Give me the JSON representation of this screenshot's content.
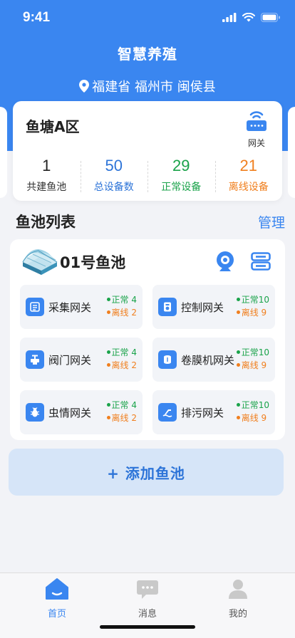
{
  "status_bar": {
    "time": "9:41"
  },
  "header": {
    "title": "智慧养殖",
    "location": "福建省 福州市 闽侯县"
  },
  "pond": {
    "name": "鱼塘A区",
    "gateway_label": "网关",
    "stats": [
      {
        "value": "1",
        "label": "共建鱼池",
        "color": "#222222"
      },
      {
        "value": "50",
        "label": "总设备数",
        "color": "#2d74d8"
      },
      {
        "value": "29",
        "label": "正常设备",
        "color": "#1aa34a"
      },
      {
        "value": "21",
        "label": "离线设备",
        "color": "#f07f1e"
      }
    ]
  },
  "section": {
    "title": "鱼池列表",
    "manage": "管理"
  },
  "pool": {
    "name": "01号鱼池",
    "gateways": [
      {
        "name": "采集网关",
        "icon": "collect-icon",
        "normal": "正常 4",
        "offline": "离线 2"
      },
      {
        "name": "控制网关",
        "icon": "control-icon",
        "normal": "正常10",
        "offline": "离线 9"
      },
      {
        "name": "阀门网关",
        "icon": "valve-icon",
        "normal": "正常 4",
        "offline": "离线 2"
      },
      {
        "name": "卷膜机网关",
        "icon": "film-roller-icon",
        "normal": "正常10",
        "offline": "离线 9"
      },
      {
        "name": "虫情网关",
        "icon": "bug-icon",
        "normal": "正常 4",
        "offline": "离线 2"
      },
      {
        "name": "排污网关",
        "icon": "drain-icon",
        "normal": "正常10",
        "offline": "离线 9"
      }
    ]
  },
  "add_button": "+ 添加鱼池",
  "tabbar": {
    "tabs": [
      {
        "label": "首页",
        "icon": "home-icon",
        "active": true
      },
      {
        "label": "消息",
        "icon": "message-icon",
        "active": false
      },
      {
        "label": "我的",
        "icon": "profile-icon",
        "active": false
      }
    ]
  },
  "colors": {
    "primary": "#3a86f0",
    "normal": "#1aa34a",
    "offline": "#f07f1e"
  }
}
